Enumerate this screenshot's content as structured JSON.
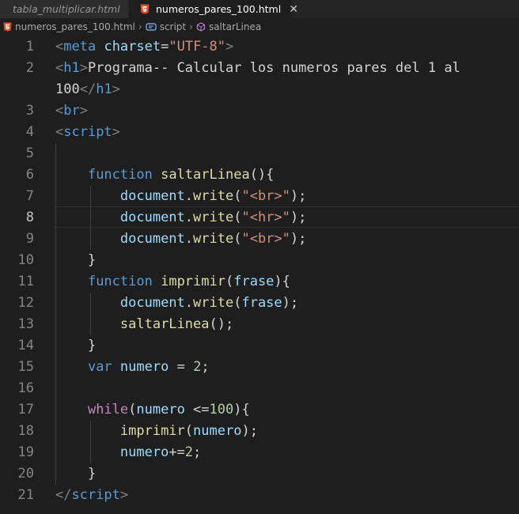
{
  "tabs": [
    {
      "label": "tabla_multiplicar.html",
      "active": false
    },
    {
      "label": "numeros_pares_100.html",
      "active": true
    }
  ],
  "breadcrumb": {
    "file": "numeros_pares_100.html",
    "scope": "script",
    "symbol": "saltarLinea"
  },
  "editor": {
    "current_line": 8,
    "lines": [
      {
        "n": "1",
        "tokens": [
          [
            "t-br",
            "<"
          ],
          [
            "t-tag",
            "meta"
          ],
          [
            "t-txt",
            " "
          ],
          [
            "t-attr",
            "charset"
          ],
          [
            "t-txt",
            "="
          ],
          [
            "t-str",
            "\"UTF-8\""
          ],
          [
            "t-br",
            ">"
          ]
        ]
      },
      {
        "n": "2",
        "tokens": [
          [
            "t-br",
            "<"
          ],
          [
            "t-tag",
            "h1"
          ],
          [
            "t-br",
            ">"
          ],
          [
            "t-txt",
            "Programa-- Calcular los numeros pares del 1 al"
          ]
        ]
      },
      {
        "n": "",
        "tokens": [
          [
            "t-txt",
            "100"
          ],
          [
            "t-br",
            "</"
          ],
          [
            "t-tag",
            "h1"
          ],
          [
            "t-br",
            ">"
          ]
        ]
      },
      {
        "n": "3",
        "tokens": [
          [
            "t-br",
            "<"
          ],
          [
            "t-tag",
            "br"
          ],
          [
            "t-br",
            ">"
          ]
        ]
      },
      {
        "n": "4",
        "tokens": [
          [
            "t-br",
            "<"
          ],
          [
            "t-tag",
            "script"
          ],
          [
            "t-br",
            ">"
          ]
        ]
      },
      {
        "n": "5",
        "tokens": []
      },
      {
        "n": "6",
        "tokens": [
          [
            "t-txt",
            "    "
          ],
          [
            "t-kw",
            "function"
          ],
          [
            "t-txt",
            " "
          ],
          [
            "t-fn",
            "saltarLinea"
          ],
          [
            "t-txt",
            "(){"
          ]
        ]
      },
      {
        "n": "7",
        "tokens": [
          [
            "t-txt",
            "        "
          ],
          [
            "t-var",
            "document"
          ],
          [
            "t-txt",
            "."
          ],
          [
            "t-fn",
            "write"
          ],
          [
            "t-txt",
            "("
          ],
          [
            "t-str",
            "\"<br>\""
          ],
          [
            "t-txt",
            ");"
          ]
        ]
      },
      {
        "n": "8",
        "tokens": [
          [
            "t-txt",
            "        "
          ],
          [
            "t-var",
            "document"
          ],
          [
            "t-txt",
            "."
          ],
          [
            "t-fn",
            "write"
          ],
          [
            "t-txt",
            "("
          ],
          [
            "t-str",
            "\"<hr>\""
          ],
          [
            "t-txt",
            ");"
          ]
        ]
      },
      {
        "n": "9",
        "tokens": [
          [
            "t-txt",
            "        "
          ],
          [
            "t-var",
            "document"
          ],
          [
            "t-txt",
            "."
          ],
          [
            "t-fn",
            "write"
          ],
          [
            "t-txt",
            "("
          ],
          [
            "t-str",
            "\"<br>\""
          ],
          [
            "t-txt",
            ");"
          ]
        ]
      },
      {
        "n": "10",
        "tokens": [
          [
            "t-txt",
            "    }"
          ]
        ]
      },
      {
        "n": "11",
        "tokens": [
          [
            "t-txt",
            "    "
          ],
          [
            "t-kw",
            "function"
          ],
          [
            "t-txt",
            " "
          ],
          [
            "t-fn",
            "imprimir"
          ],
          [
            "t-txt",
            "("
          ],
          [
            "t-var",
            "frase"
          ],
          [
            "t-txt",
            "){"
          ]
        ]
      },
      {
        "n": "12",
        "tokens": [
          [
            "t-txt",
            "        "
          ],
          [
            "t-var",
            "document"
          ],
          [
            "t-txt",
            "."
          ],
          [
            "t-fn",
            "write"
          ],
          [
            "t-txt",
            "("
          ],
          [
            "t-var",
            "frase"
          ],
          [
            "t-txt",
            ");"
          ]
        ]
      },
      {
        "n": "13",
        "tokens": [
          [
            "t-txt",
            "        "
          ],
          [
            "t-fn",
            "saltarLinea"
          ],
          [
            "t-txt",
            "();"
          ]
        ]
      },
      {
        "n": "14",
        "tokens": [
          [
            "t-txt",
            "    }"
          ]
        ]
      },
      {
        "n": "15",
        "tokens": [
          [
            "t-txt",
            "    "
          ],
          [
            "t-kw",
            "var"
          ],
          [
            "t-txt",
            " "
          ],
          [
            "t-var",
            "numero"
          ],
          [
            "t-txt",
            " = "
          ],
          [
            "t-num",
            "2"
          ],
          [
            "t-txt",
            ";"
          ]
        ]
      },
      {
        "n": "16",
        "tokens": []
      },
      {
        "n": "17",
        "tokens": [
          [
            "t-txt",
            "    "
          ],
          [
            "t-ctl",
            "while"
          ],
          [
            "t-txt",
            "("
          ],
          [
            "t-var",
            "numero"
          ],
          [
            "t-txt",
            " <="
          ],
          [
            "t-num",
            "100"
          ],
          [
            "t-txt",
            "){"
          ]
        ]
      },
      {
        "n": "18",
        "tokens": [
          [
            "t-txt",
            "        "
          ],
          [
            "t-fn",
            "imprimir"
          ],
          [
            "t-txt",
            "("
          ],
          [
            "t-var",
            "numero"
          ],
          [
            "t-txt",
            ");"
          ]
        ]
      },
      {
        "n": "19",
        "tokens": [
          [
            "t-txt",
            "        "
          ],
          [
            "t-var",
            "numero"
          ],
          [
            "t-txt",
            "+="
          ],
          [
            "t-num",
            "2"
          ],
          [
            "t-txt",
            ";"
          ]
        ]
      },
      {
        "n": "20",
        "tokens": [
          [
            "t-txt",
            "    }"
          ]
        ]
      },
      {
        "n": "21",
        "tokens": [
          [
            "t-br",
            "</"
          ],
          [
            "t-tag",
            "script"
          ],
          [
            "t-br",
            ">"
          ]
        ]
      }
    ]
  }
}
